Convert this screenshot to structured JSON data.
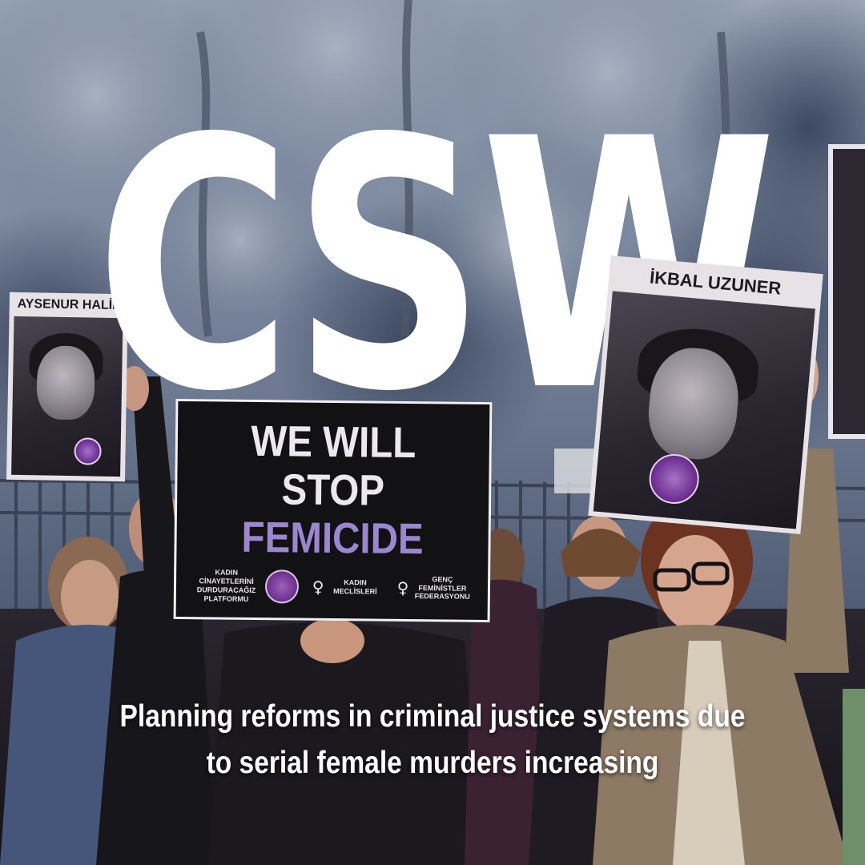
{
  "headline": "CSW",
  "subtitle_line1": "Planning reforms in criminal justice systems due",
  "subtitle_line2": "to serial female murders increasing",
  "placards": {
    "main": {
      "line1": "WE WILL",
      "line2": "STOP",
      "line3": "FEMICIDE",
      "org1_line1": "KADIN",
      "org1_line2": "CİNAYETLERİNİ",
      "org1_line3": "DURDURACAĞIZ",
      "org1_line4": "PLATFORMU",
      "org2": "KADIN MECLİSLERİ",
      "org3_line1": "GENÇ",
      "org3_line2": "FEMİNİSTLER",
      "org3_line3": "FEDERASYONU"
    },
    "left_portrait_name": "AYSENUR HALİL",
    "right_portrait_name": "İKBAL UZUNER"
  },
  "colors": {
    "headline": "#ffffff",
    "placard_accent": "#9b87cf",
    "placard_background": "#121114",
    "badge_purple": "#6b2e8e"
  },
  "icons": [
    "venus-symbol-icon",
    "platform-badge-icon"
  ]
}
